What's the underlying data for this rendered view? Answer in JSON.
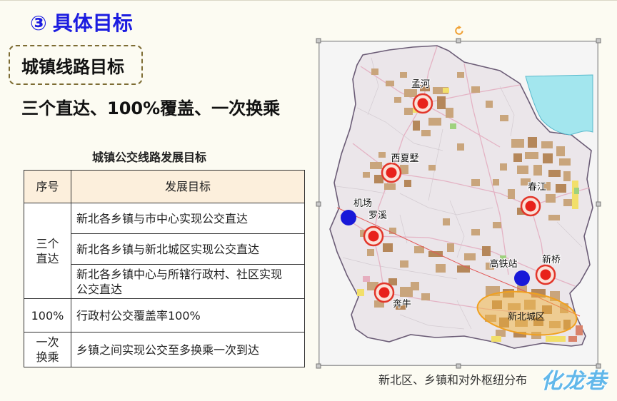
{
  "slide": {
    "section_number": "③",
    "section_title": "具体目标",
    "callout_label": "城镇线路目标",
    "headline": "三个直达、100%覆盖、一次换乘"
  },
  "table": {
    "title": "城镇公交线路发展目标",
    "headers": [
      "序号",
      "发展目标"
    ],
    "rows": [
      {
        "category": "三个直达",
        "goals": [
          "新北各乡镇与市中心实现公交直达",
          "新北各乡镇与新北城区实现公交直达",
          "新北各乡镇中心与所辖行政村、社区实现公交直达"
        ]
      },
      {
        "category": "100%",
        "goals": [
          "行政村公交覆盖率100%"
        ]
      },
      {
        "category": "一次换乘",
        "goals": [
          "乡镇之间实现公交至多换乘一次到达"
        ]
      }
    ]
  },
  "map": {
    "towns": [
      "孟河",
      "西夏墅",
      "春江",
      "罗溪",
      "新桥",
      "奔牛"
    ],
    "hubs": [
      "机场",
      "高铁站"
    ],
    "urban_area": "新北城区",
    "caption": "新北区、乡镇和对外枢纽分布",
    "icons": {
      "rotate_handle": "rotate-icon",
      "resize_handle": "resize-handle-icon"
    }
  },
  "logo": {
    "text": "化龙巷"
  },
  "colors": {
    "title": "#1c1ce0",
    "table_header_bg": "#fcefdc",
    "callout_border": "#7d6c33",
    "town_marker": "#e8221b",
    "town_ring": "#e2362a",
    "hub_marker": "#1818d8",
    "urban_area": "#f2b13a",
    "logo": "#62b8ea"
  }
}
